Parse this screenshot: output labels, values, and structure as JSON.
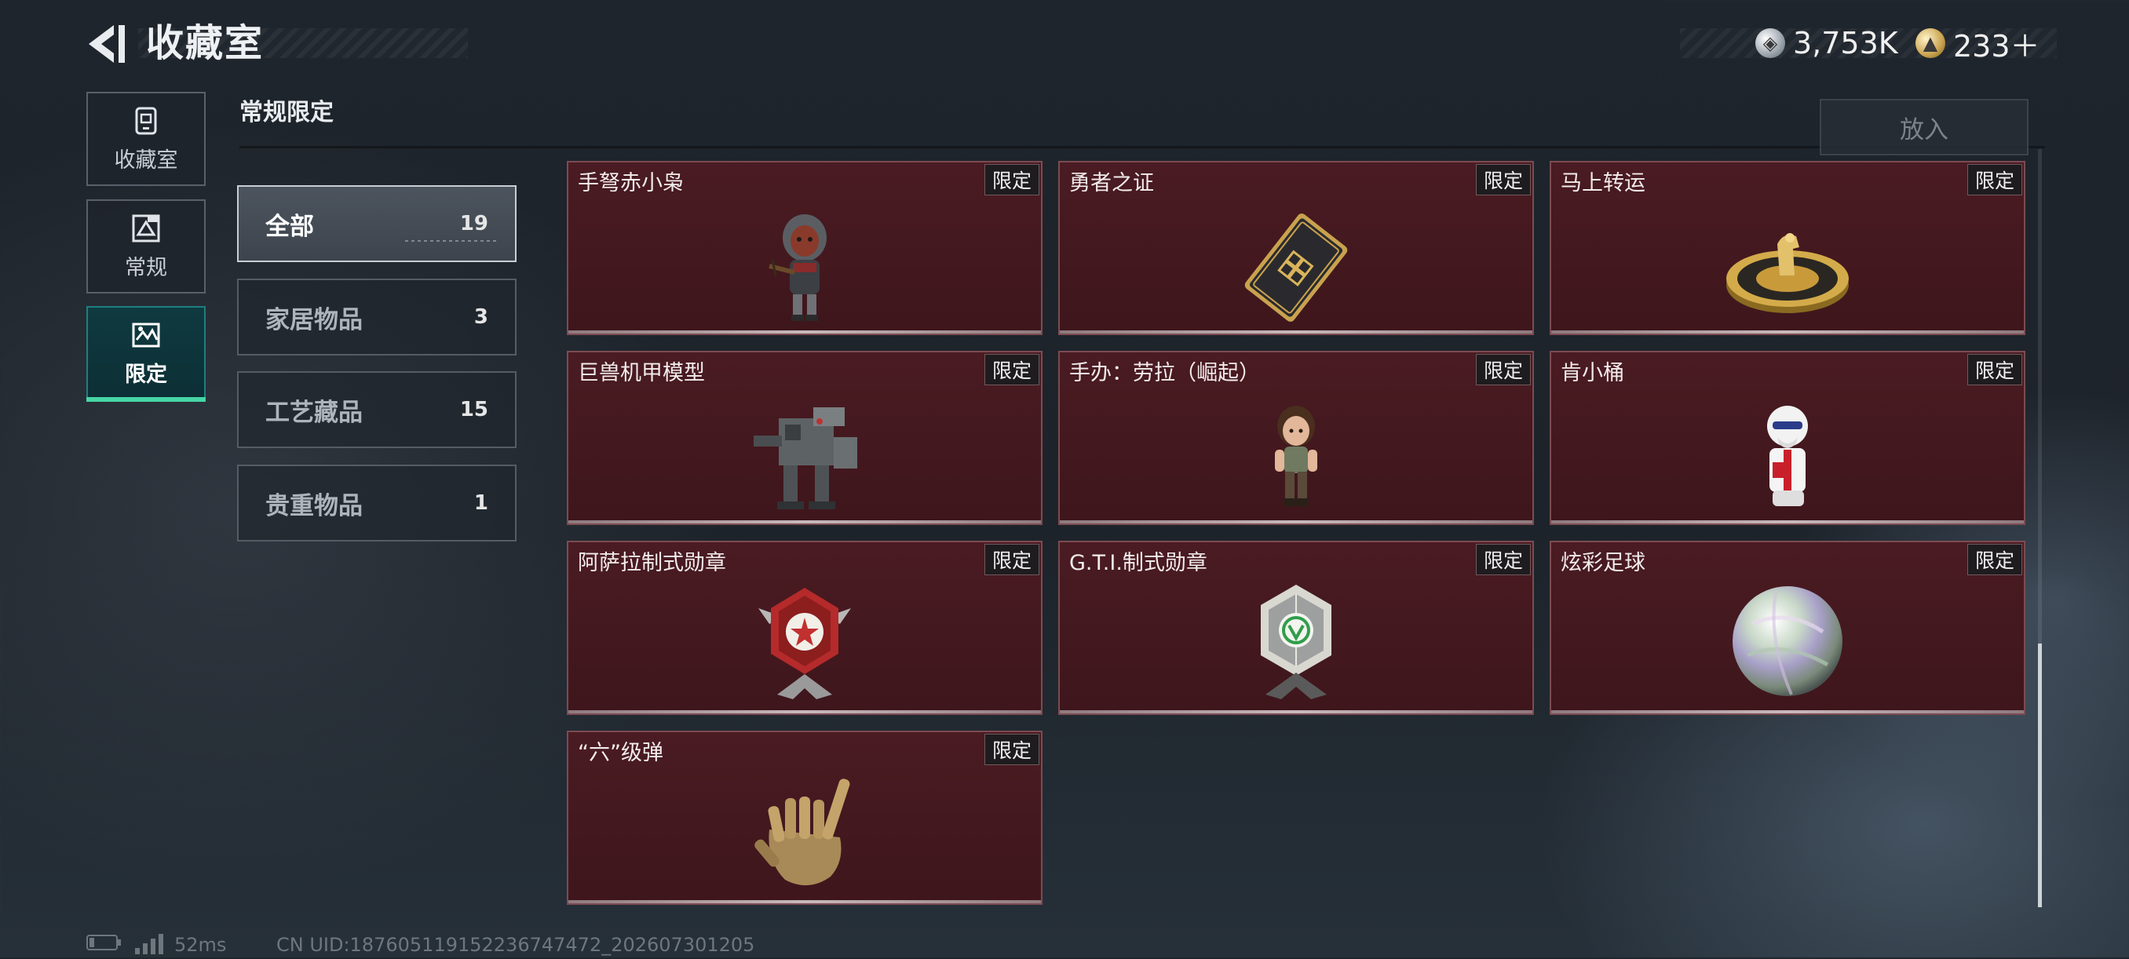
{
  "header": {
    "title": "收藏室",
    "back_icon": "back-arrow-icon"
  },
  "currency": [
    {
      "icon": "silver-coin-icon",
      "value": "3,753K"
    },
    {
      "icon": "gold-coin-icon",
      "value": "233＋"
    }
  ],
  "nav": [
    {
      "label": "收藏室",
      "icon": "collection-icon",
      "active": false
    },
    {
      "label": "常规",
      "icon": "regular-icon",
      "active": false
    },
    {
      "label": "限定",
      "icon": "limited-icon",
      "active": true
    }
  ],
  "section_title": "常规限定",
  "put_in_button": "放入",
  "categories": [
    {
      "name": "全部",
      "count": "19",
      "active": true
    },
    {
      "name": "家居物品",
      "count": "3",
      "active": false
    },
    {
      "name": "工艺藏品",
      "count": "15",
      "active": false
    },
    {
      "name": "贵重物品",
      "count": "1",
      "active": false
    }
  ],
  "items": [
    {
      "name": "手弩赤小枭",
      "badge": "限定",
      "icon": "crossbow-figure-icon"
    },
    {
      "name": "勇者之证",
      "badge": "限定",
      "icon": "card-token-icon"
    },
    {
      "name": "马上转运",
      "badge": "限定",
      "icon": "golden-horse-disc-icon"
    },
    {
      "name": "巨兽机甲模型",
      "badge": "限定",
      "icon": "mech-model-icon"
    },
    {
      "name": "手办：劳拉（崛起）",
      "badge": "限定",
      "icon": "lara-figure-icon"
    },
    {
      "name": "肯小桶",
      "badge": "限定",
      "icon": "colonel-figure-icon"
    },
    {
      "name": "阿萨拉制式勋章",
      "badge": "限定",
      "icon": "red-medal-icon"
    },
    {
      "name": "G.T.I.制式勋章",
      "badge": "限定",
      "icon": "green-medal-icon"
    },
    {
      "name": "炫彩足球",
      "badge": "限定",
      "icon": "iridescent-ball-icon"
    },
    {
      "name": "“六”级弹",
      "badge": "限定",
      "icon": "bullet-hand-icon"
    }
  ],
  "footer": {
    "ping": "52ms",
    "uid": "CN UID:187605119152236747472_202607301205"
  }
}
